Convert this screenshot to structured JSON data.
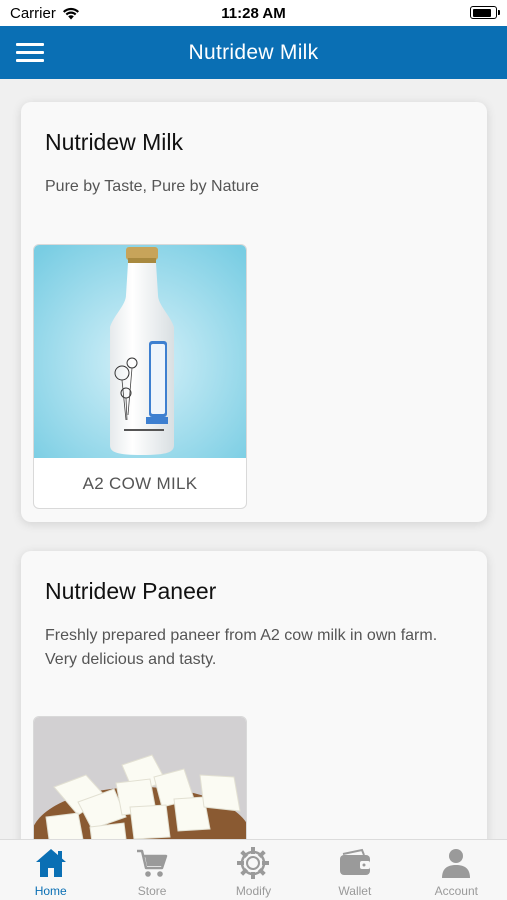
{
  "status": {
    "carrier": "Carrier",
    "time": "11:28 AM",
    "battery_level": 0.85
  },
  "header": {
    "title": "Nutridew Milk"
  },
  "cards": [
    {
      "title": "Nutridew Milk",
      "description": "Pure by Taste, Pure by Nature",
      "product_label": "A2 COW MILK"
    },
    {
      "title": "Nutridew Paneer",
      "description": "Freshly prepared paneer from A2 cow milk in own farm. Very delicious and tasty."
    }
  ],
  "tabs": [
    {
      "label": "Home",
      "icon": "home-icon",
      "active": true
    },
    {
      "label": "Store",
      "icon": "cart-icon",
      "active": false
    },
    {
      "label": "Modify",
      "icon": "gear-icon",
      "active": false
    },
    {
      "label": "Wallet",
      "icon": "wallet-icon",
      "active": false
    },
    {
      "label": "Account",
      "icon": "user-icon",
      "active": false
    }
  ],
  "colors": {
    "primary": "#0a6fb4",
    "inactive": "#9a9a9a",
    "background": "#f0f0f0"
  }
}
